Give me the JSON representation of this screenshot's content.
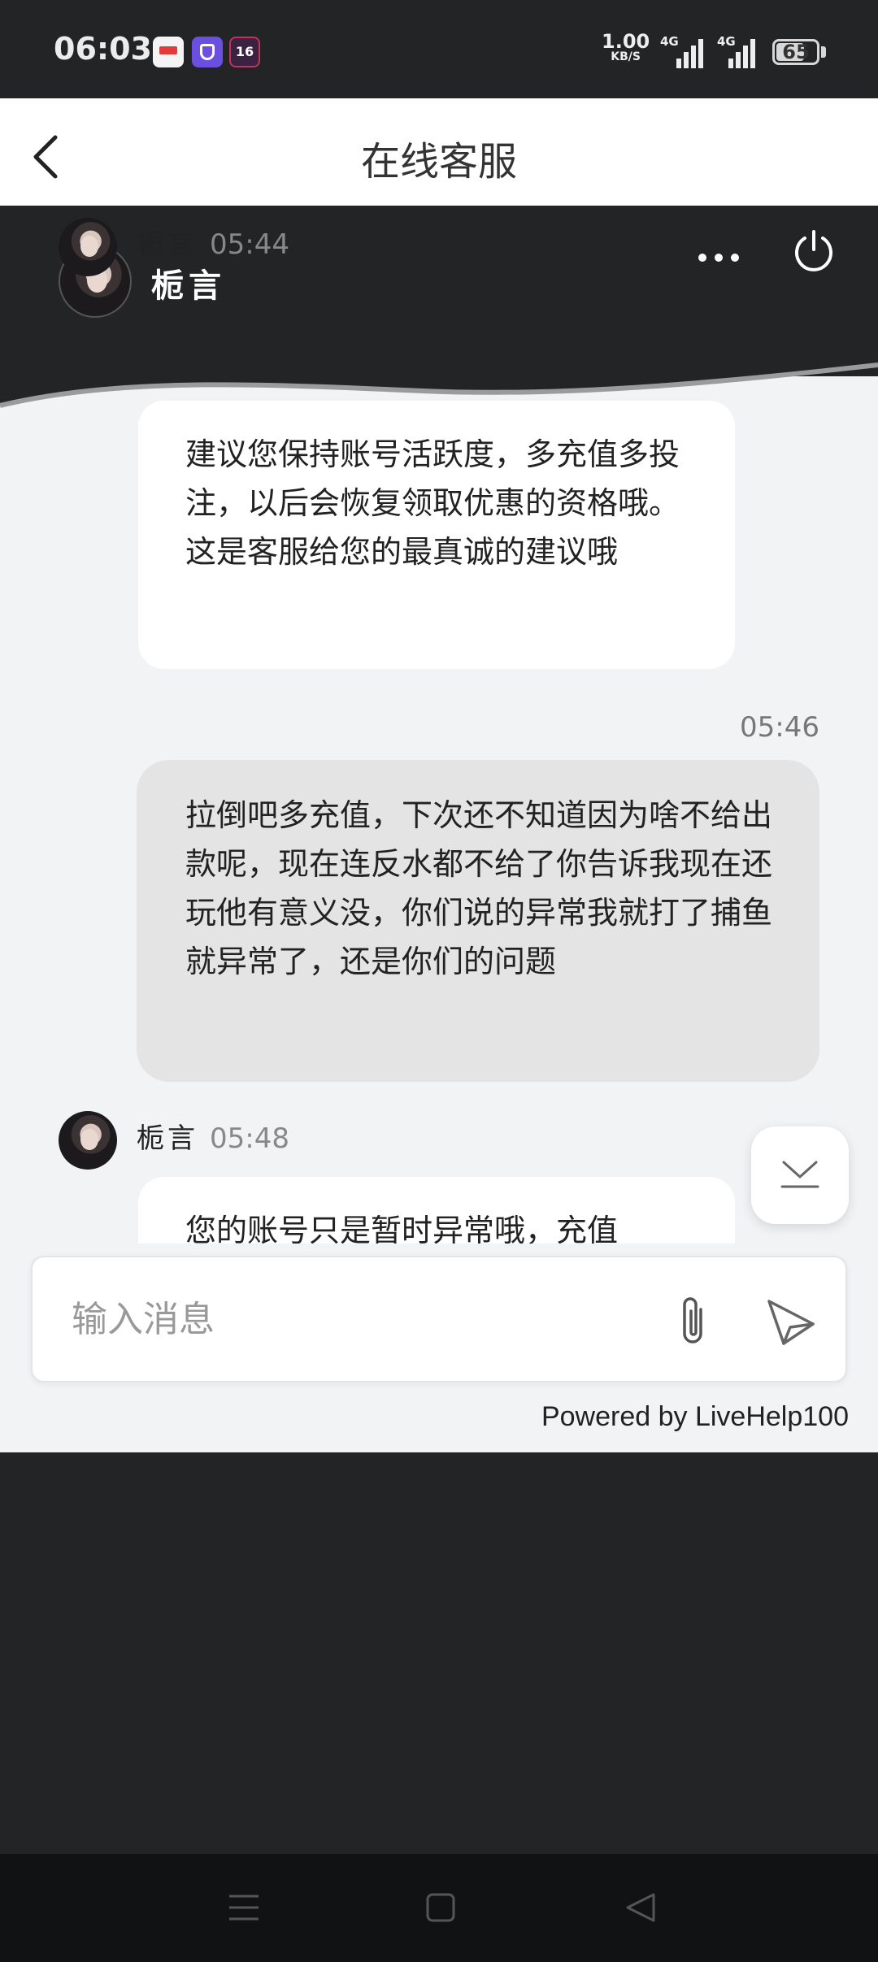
{
  "status_bar": {
    "time": "06:03",
    "app3_label": "16",
    "speed_value": "1.00",
    "speed_unit": "KB/S",
    "sim1": "4G",
    "sim2": "4G",
    "battery": "65"
  },
  "nav": {
    "title": "在线客服",
    "back_icon": "chevron-left-icon"
  },
  "chat_header": {
    "agent_name": "栀言",
    "more_icon": "more-horizontal-icon",
    "power_icon": "power-icon"
  },
  "messages": [
    {
      "side": "agent",
      "name": "栀言",
      "time": "05:44",
      "text": "建议您保持账号活跃度，多充值多投注，以后会恢复领取优惠的资格哦。这是客服给您的最真诚的建议哦"
    },
    {
      "side": "user",
      "time": "05:46",
      "text": "拉倒吧多充值，下次还不知道因为啥不给出款呢，现在连反水都不给了你告诉我现在还玩他有意义没，你们说的异常我就打了捕鱼就异常了，还是你们的问题"
    },
    {
      "side": "agent",
      "name": "栀言",
      "time": "05:48",
      "text": "您的账号只是暂时异常哦，充值"
    }
  ],
  "input": {
    "placeholder": "输入消息",
    "value": "",
    "attach_icon": "paperclip-icon",
    "send_icon": "send-icon"
  },
  "footer": {
    "powered_by": "Powered by LiveHelp100"
  },
  "colors": {
    "header_dark": "#222426",
    "chat_bg": "#f2f3f5",
    "agent_bubble": "#ffffff",
    "user_bubble": "#e4e4e4"
  }
}
